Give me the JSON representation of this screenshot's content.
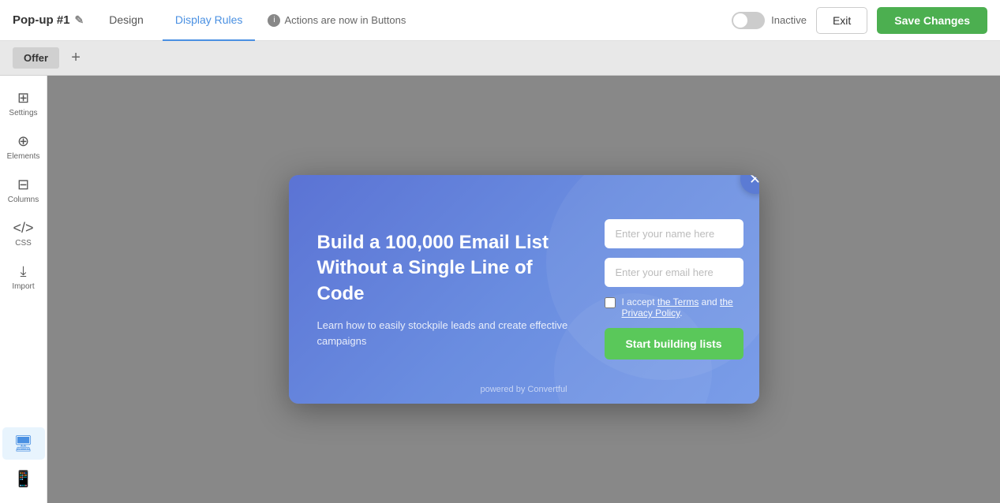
{
  "topbar": {
    "popup_title": "Pop-up #1",
    "edit_icon": "✎",
    "tab_design": "Design",
    "tab_display_rules": "Display Rules",
    "actions_notice": "Actions are now in Buttons",
    "toggle_label": "Inactive",
    "exit_label": "Exit",
    "save_label": "Save Changes"
  },
  "offerbar": {
    "offer_tab": "Offer",
    "add_icon": "+"
  },
  "sidebar": {
    "settings_label": "Settings",
    "elements_label": "Elements",
    "columns_label": "Columns",
    "css_label": "CSS",
    "import_label": "Import",
    "desktop_label": "",
    "mobile_label": ""
  },
  "popup": {
    "headline": "Build a 100,000 Email List Without a Single Line of Code",
    "subtext": "Learn how to easily stockpile leads and create effective campaigns",
    "name_placeholder": "Enter your name here",
    "email_placeholder": "Enter your email here",
    "checkbox_text": "I accept ",
    "terms_link": "the Terms",
    "and_text": " and ",
    "privacy_link": "the Privacy Policy",
    "period": ".",
    "submit_label": "Start building lists",
    "close_icon": "✕",
    "powered_by": "powered by Convertful"
  }
}
